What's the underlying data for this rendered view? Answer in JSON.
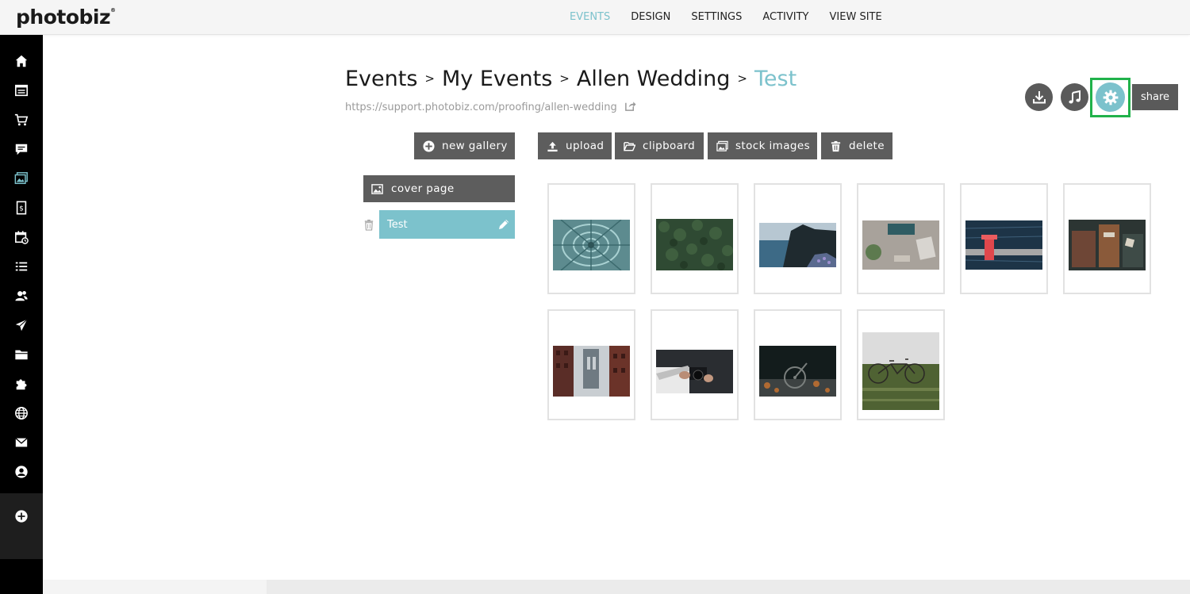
{
  "app": {
    "logo": "photobiz",
    "logo_mark": "®"
  },
  "topnav": [
    {
      "label": "EVENTS",
      "active": true
    },
    {
      "label": "DESIGN",
      "active": false
    },
    {
      "label": "SETTINGS",
      "active": false
    },
    {
      "label": "ACTIVITY",
      "active": false
    },
    {
      "label": "VIEW SITE",
      "active": false
    }
  ],
  "sidebar": {
    "icons": [
      "home-icon",
      "website-pages-icon",
      "cart-icon",
      "comment-icon",
      "gallery-icon",
      "invoice-icon",
      "calendar-icon",
      "list-icon",
      "contacts-icon",
      "send-icon",
      "folder-icon",
      "puzzle-icon",
      "globe-icon",
      "mail-icon",
      "account-icon",
      "add-icon"
    ],
    "active": "gallery-icon"
  },
  "breadcrumb": {
    "items": [
      "Events",
      "My Events",
      "Allen Wedding",
      "Test"
    ],
    "separator": ">"
  },
  "event_url": "https://support.photobiz.com/proofing/allen-wedding",
  "header_actions": {
    "download_icon": "download-icon",
    "music_icon": "music-icon",
    "settings_icon": "gear-icon",
    "share_label": "share"
  },
  "toolbar": {
    "new_gallery": "new gallery",
    "upload": "upload",
    "clipboard": "clipboard",
    "stock_images": "stock images",
    "delete": "delete"
  },
  "galleries": {
    "cover_page": "cover page",
    "items": [
      {
        "label": "Test",
        "selected": true
      }
    ]
  },
  "thumbnails": [
    {
      "subject": "succulent"
    },
    {
      "subject": "forest"
    },
    {
      "subject": "coastal-cliff"
    },
    {
      "subject": "desk-typewriter"
    },
    {
      "subject": "red-pier"
    },
    {
      "subject": "suitcases"
    },
    {
      "subject": "bridge-city"
    },
    {
      "subject": "camera-hands"
    },
    {
      "subject": "bicycle-night"
    },
    {
      "subject": "bicycle-field"
    }
  ],
  "colors": {
    "accent": "#7cc2cc",
    "button_gray": "#5d5d5d",
    "highlight_frame": "#21b24b",
    "sidebar": "#000000"
  }
}
